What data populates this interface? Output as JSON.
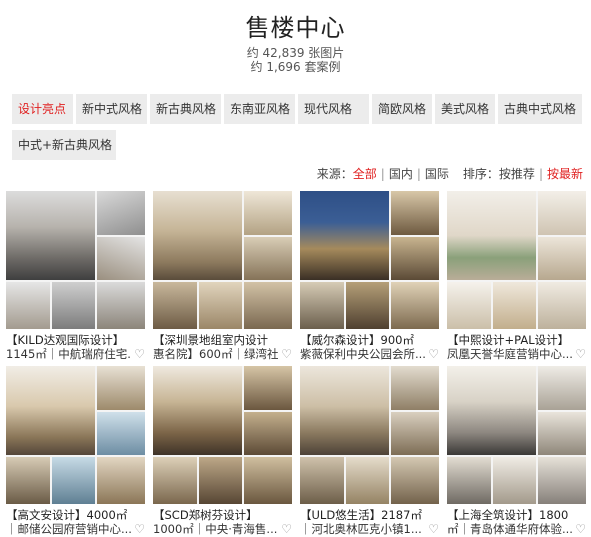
{
  "page": {
    "title": "售楼中心",
    "stat_images": "约 42,839 张图片",
    "stat_cases": "约 1,696 套案例"
  },
  "tags": [
    {
      "label": "设计亮点",
      "active": true
    },
    {
      "label": "新中式风格",
      "active": false
    },
    {
      "label": "新古典风格",
      "active": false
    },
    {
      "label": "东南亚风格",
      "active": false
    },
    {
      "label": "现代风格",
      "active": false
    },
    {
      "label": "简欧风格",
      "active": false
    },
    {
      "label": "美式风格",
      "active": false
    },
    {
      "label": "古典中式风格",
      "active": false
    },
    {
      "label": "中式+新古典风格",
      "active": false
    }
  ],
  "filter": {
    "source_label": "来源：",
    "source_all": "全部",
    "source_domestic": "国内",
    "source_intl": "国际",
    "sort_label": "排序：",
    "sort_recommend": "按推荐",
    "sort_latest": "按最新"
  },
  "cards": [
    {
      "line1": "【KILD达观国际设计】",
      "line2": "1145㎡｜中航瑞府住宅..."
    },
    {
      "line1": "【深圳景地组室内设计",
      "line2": "惠名院】600㎡｜绿湾社..."
    },
    {
      "line1": "【威尔森设计】900㎡",
      "line2": "紫薇保利中央公园会所..."
    },
    {
      "line1": "【中熙设计+PAL设计】",
      "line2": "凤凰天誉华庭营销中心..."
    },
    {
      "line1": "【高文安设计】4000㎡",
      "line2": "｜邮储公园府营销中心..."
    },
    {
      "line1": "【SCD郑树芬设计】",
      "line2": "1000㎡｜中央·青海售..."
    },
    {
      "line1": "【ULD悠生活】2187㎡",
      "line2": "｜河北奥林匹克小镇1..."
    },
    {
      "line1": "【上海全筑设计】1800",
      "line2": "㎡｜青岛体通华府体验..."
    }
  ],
  "icons": {
    "favorite": "heart-icon"
  },
  "colors": {
    "accent": "#e02020",
    "tag_bg": "#ececec"
  }
}
